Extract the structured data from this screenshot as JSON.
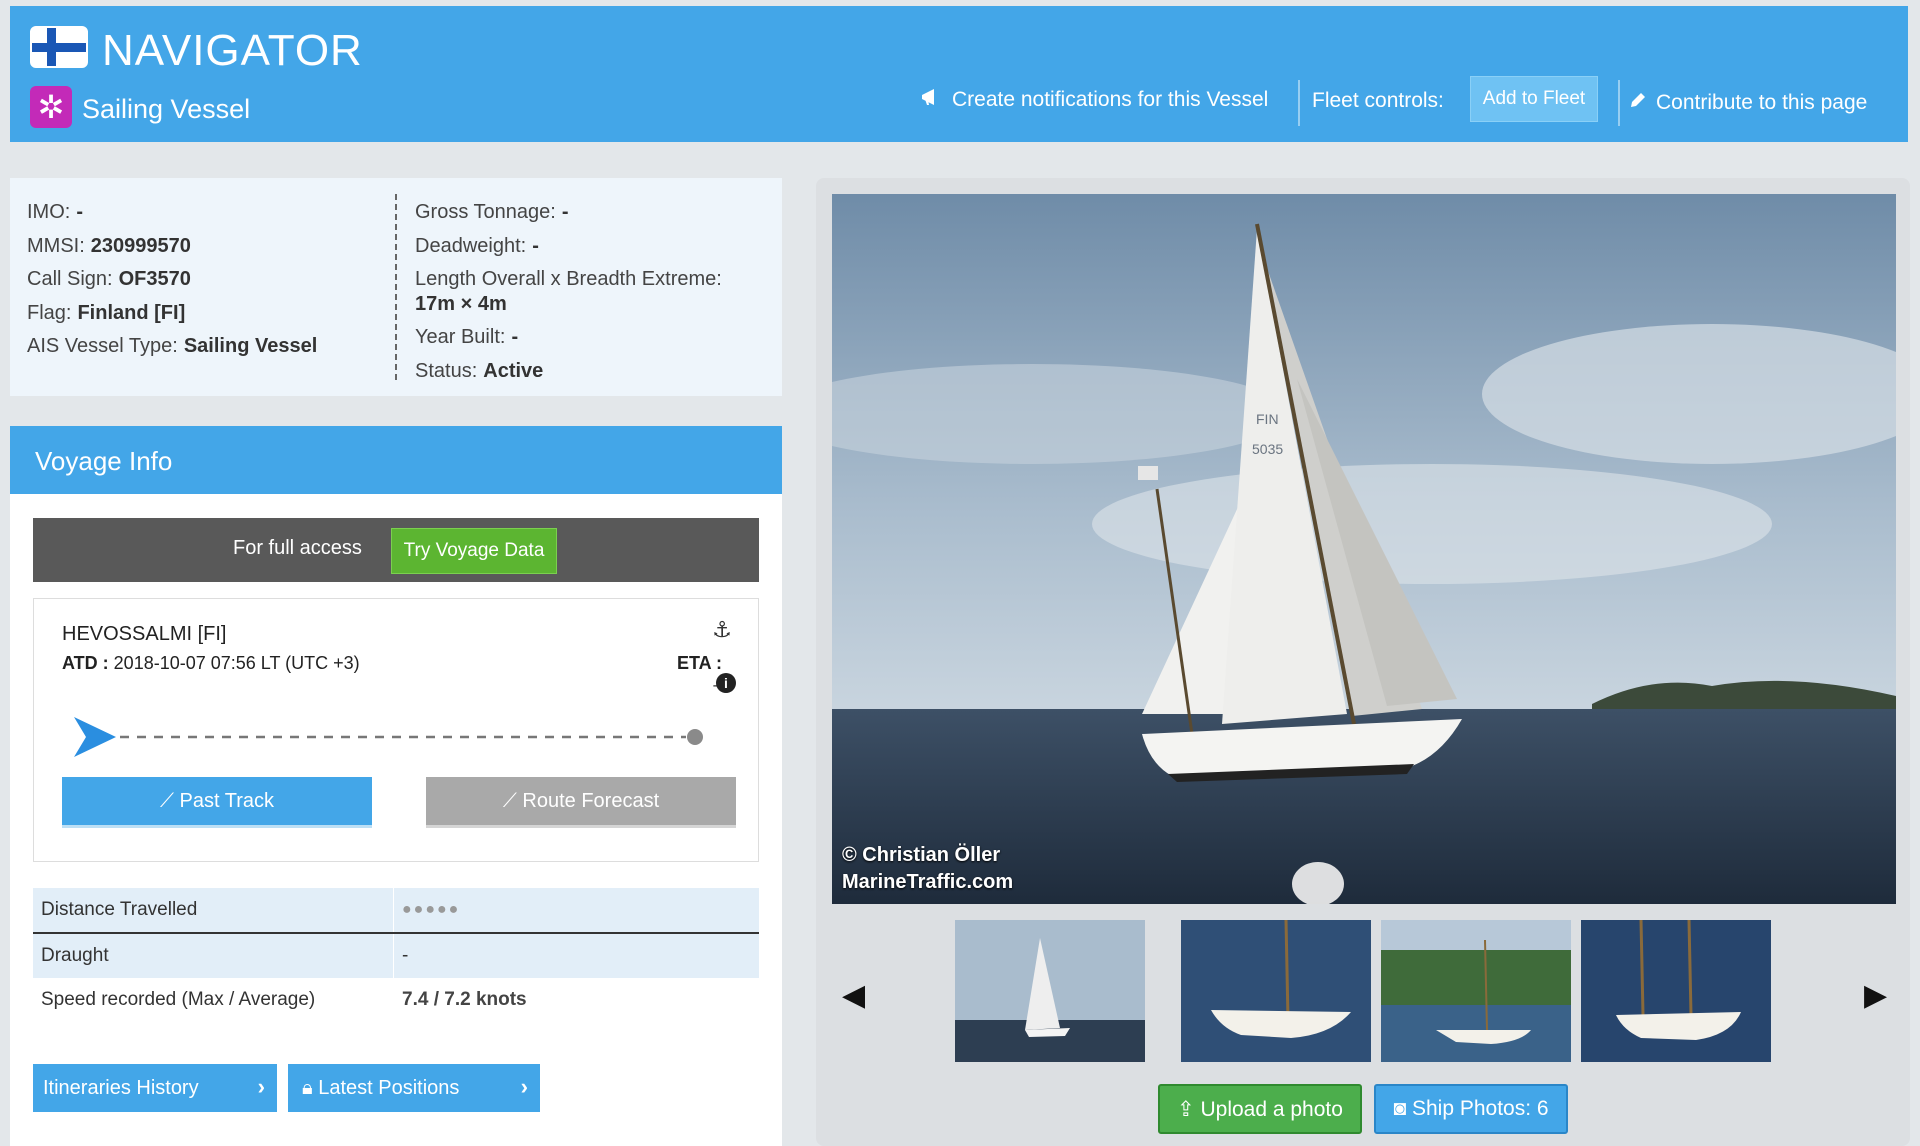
{
  "header": {
    "brand": "NAVIGATOR",
    "vessel_type": "Sailing Vessel",
    "notify_label": "Create notifications for this Vessel",
    "fleet_label": "Fleet controls:",
    "add_fleet_label": "Add to Fleet",
    "contribute_label": "Contribute to this page"
  },
  "details": {
    "left": [
      {
        "label": "IMO:",
        "value": "-"
      },
      {
        "label": "MMSI:",
        "value": "230999570"
      },
      {
        "label": "Call Sign:",
        "value": "OF3570"
      },
      {
        "label": "Flag:",
        "value": "Finland [FI]"
      },
      {
        "label": "AIS Vessel Type:",
        "value": "Sailing Vessel"
      }
    ],
    "right": {
      "gross_tonnage_label": "Gross Tonnage:",
      "gross_tonnage": "-",
      "deadweight_label": "Deadweight:",
      "deadweight": "-",
      "length_label": "Length Overall x Breadth Extreme:",
      "length": "17m × 4m",
      "year_label": "Year Built:",
      "year": "-",
      "status_label": "Status:",
      "status": "Active"
    }
  },
  "voyage": {
    "title": "Voyage Info",
    "access_text": "For full access",
    "try_label": "Try Voyage Data",
    "departure_port": "HEVOSSALMI [FI]",
    "atd_label": "ATD :",
    "atd_value": "2018-10-07 07:56 LT (UTC +3)",
    "eta_label": "ETA :",
    "eta_value": "-",
    "past_track_label": "Past Track",
    "route_forecast_label": "Route Forecast",
    "stats": [
      {
        "label": "Distance Travelled",
        "value": "●●●●●"
      },
      {
        "label": "Draught",
        "value": "-"
      },
      {
        "label": "Speed recorded (Max / Average)",
        "value": "7.4 / 7.2 knots"
      }
    ],
    "itineraries_label": "Itineraries History",
    "latest_positions_label": "Latest Positions"
  },
  "photos": {
    "credit_line1": "© Christian Öller",
    "credit_line2": "MarineTraffic.com",
    "upload_label": "Upload a photo",
    "ship_photos_label": "Ship Photos: 6"
  },
  "colors": {
    "accent": "#43a6e8",
    "try_green": "#5cb531",
    "vessel_icon": "#c32ab8"
  }
}
